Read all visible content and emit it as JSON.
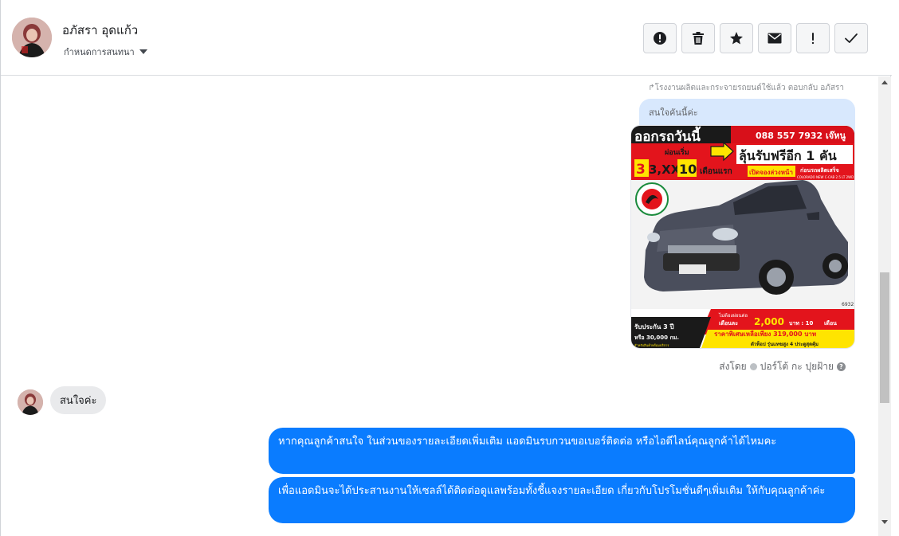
{
  "conversation": {
    "contact_name": "อภัสรา อุดแก้ว",
    "assign_label": "กำหนดการสนทนา"
  },
  "toolbar": {
    "icons": [
      "alert-circle-icon",
      "trash-icon",
      "star-icon",
      "envelope-icon",
      "exclamation-icon",
      "check-icon"
    ]
  },
  "thread": {
    "replied_to": "โรงงานผลิตและกระจายรถยนต์ใช้แล้ว ตอบกลับ อภัสรา",
    "quoted_message": "สนใจคันนี้ค่ะ",
    "sent_by_prefix": "ส่งโดย",
    "sent_by_name": "ปอร์โต้ กะ ปุยฝ้าย",
    "customer_message": "สนใจค่ะ",
    "agent_messages": [
      "หากคุณลูกค้าสนใจ ในส่วนของรายละเอียดเพิ่มเติม แอดมินรบกวนขอเบอร์ติดต่อ หรือไอดีไลน์คุณลูกค้าได้ไหมคะ",
      "เพื่อแอดมินจะได้ประสานงานให้เซลล์ได้ติดต่อดูแลพร้อมทั้งชี้แจงรายละเอียด เกี่ยวกับโปรโมชั่นดีๆเพิ่มเติม ให้กับคุณลูกค้าค่ะ"
    ]
  },
  "ad_image": {
    "headline": "ออกรถวันนี้",
    "phone": "088 557 7932 เจ๊หนู",
    "prize": "ลุ้นรับฟรีอีก 1 คัน",
    "down_label": "ผ่อนเริ่ม",
    "price_big": "3,XXX",
    "months_big": "10",
    "months_label": "เดือนแรก",
    "booking": "เปิดจองล่วงหน้า",
    "before_label": "ก่อนรถผลิตเสร็จ",
    "model": "COLORADO NEW C-CAB 2.5 LT 2WD",
    "stock_no": "6932",
    "promo1": "ไม่ต้องผ่อนต่อ",
    "promo2": "เดือนละ",
    "promo_amount": "2,000",
    "promo_unit": "บาท : 10",
    "promo_months": "เดือน",
    "warranty1": "รับประกัน 3 ปี",
    "warranty2": "หรือ 30,000 กม.",
    "special_price": "ราคาพิเศษเหลือเพียง 319,000 บาท",
    "contact_line": "ตัวท็อป รุ่นแทฆสูง 4 ประตูสุดคุ้ม",
    "small_note": "สำหรับสินค้าพร้อมบริการ",
    "colors": {
      "red": "#e3141c",
      "yellow": "#ffe400",
      "dark": "#1a1a1a",
      "body": "#4a4e5c"
    }
  },
  "colors": {
    "agent_bubble": "#0a7cff",
    "customer_bubble": "#e9eaec",
    "quoted_bubble": "#d8e8fd"
  }
}
